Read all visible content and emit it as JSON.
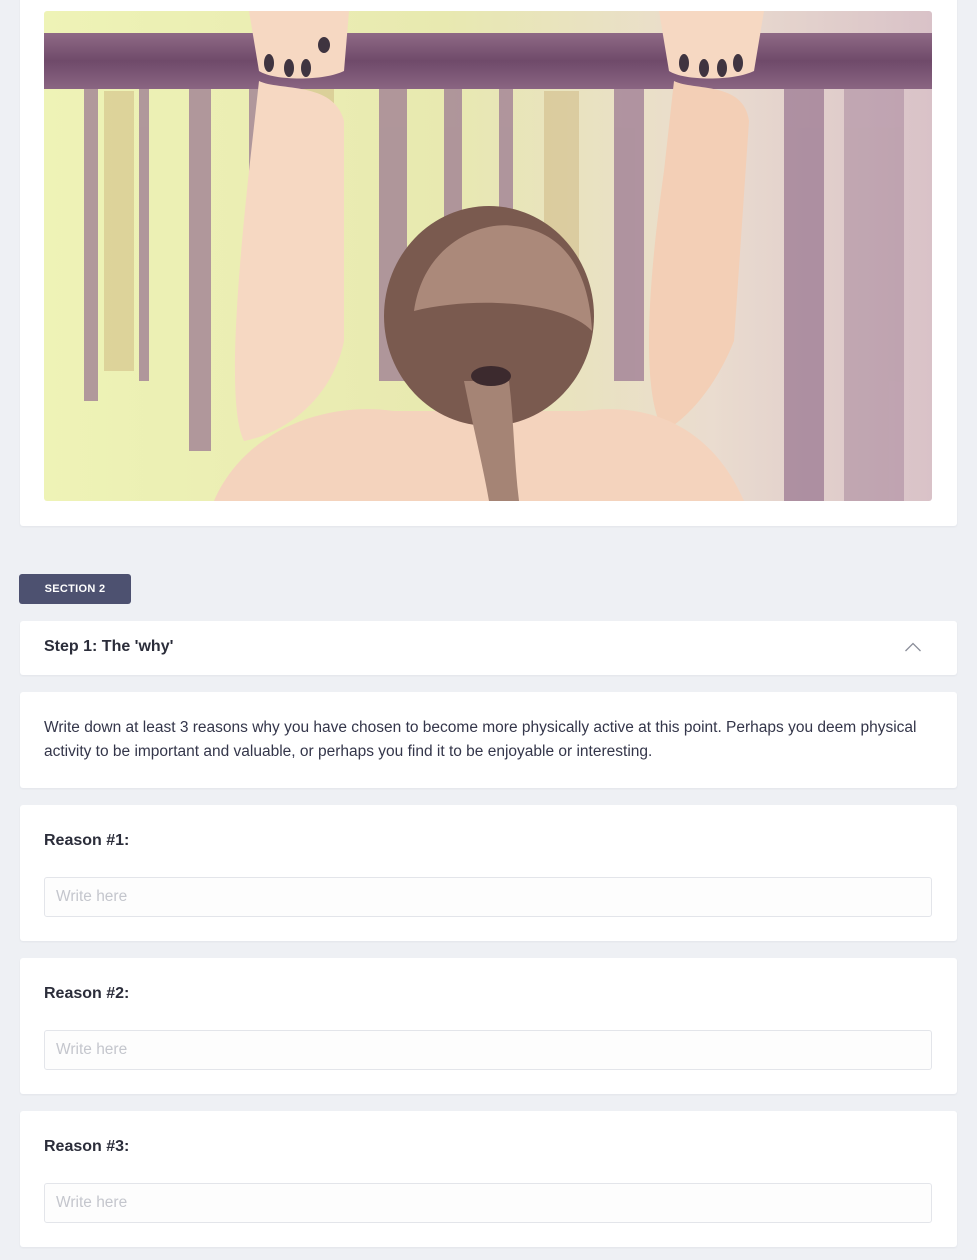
{
  "hero": {
    "image_alt": "Woman hanging from a pull-up bar outdoors, seen from behind",
    "colors": {
      "sky": "#eef0b8",
      "bar": "#6f4a6a",
      "skin": "#f6d8c2",
      "hair": "#7a5a4f"
    }
  },
  "section": {
    "badge": "SECTION 2"
  },
  "step": {
    "title": "Step 1: The 'why'",
    "toggle_icon": "chevron-up-icon"
  },
  "intro": {
    "text": "Write down at least 3 reasons why you have chosen to become more physically active at this point. Perhaps you deem physical activity to be important and valuable, or perhaps you find it to be enjoyable or interesting."
  },
  "reasons": [
    {
      "label": "Reason #1:",
      "placeholder": "Write here",
      "value": ""
    },
    {
      "label": "Reason #2:",
      "placeholder": "Write here",
      "value": ""
    },
    {
      "label": "Reason #3:",
      "placeholder": "Write here",
      "value": ""
    }
  ],
  "colors": {
    "background": "#eef0f4",
    "badge": "#4d5170",
    "card": "#ffffff",
    "text": "#2b2d3a"
  }
}
